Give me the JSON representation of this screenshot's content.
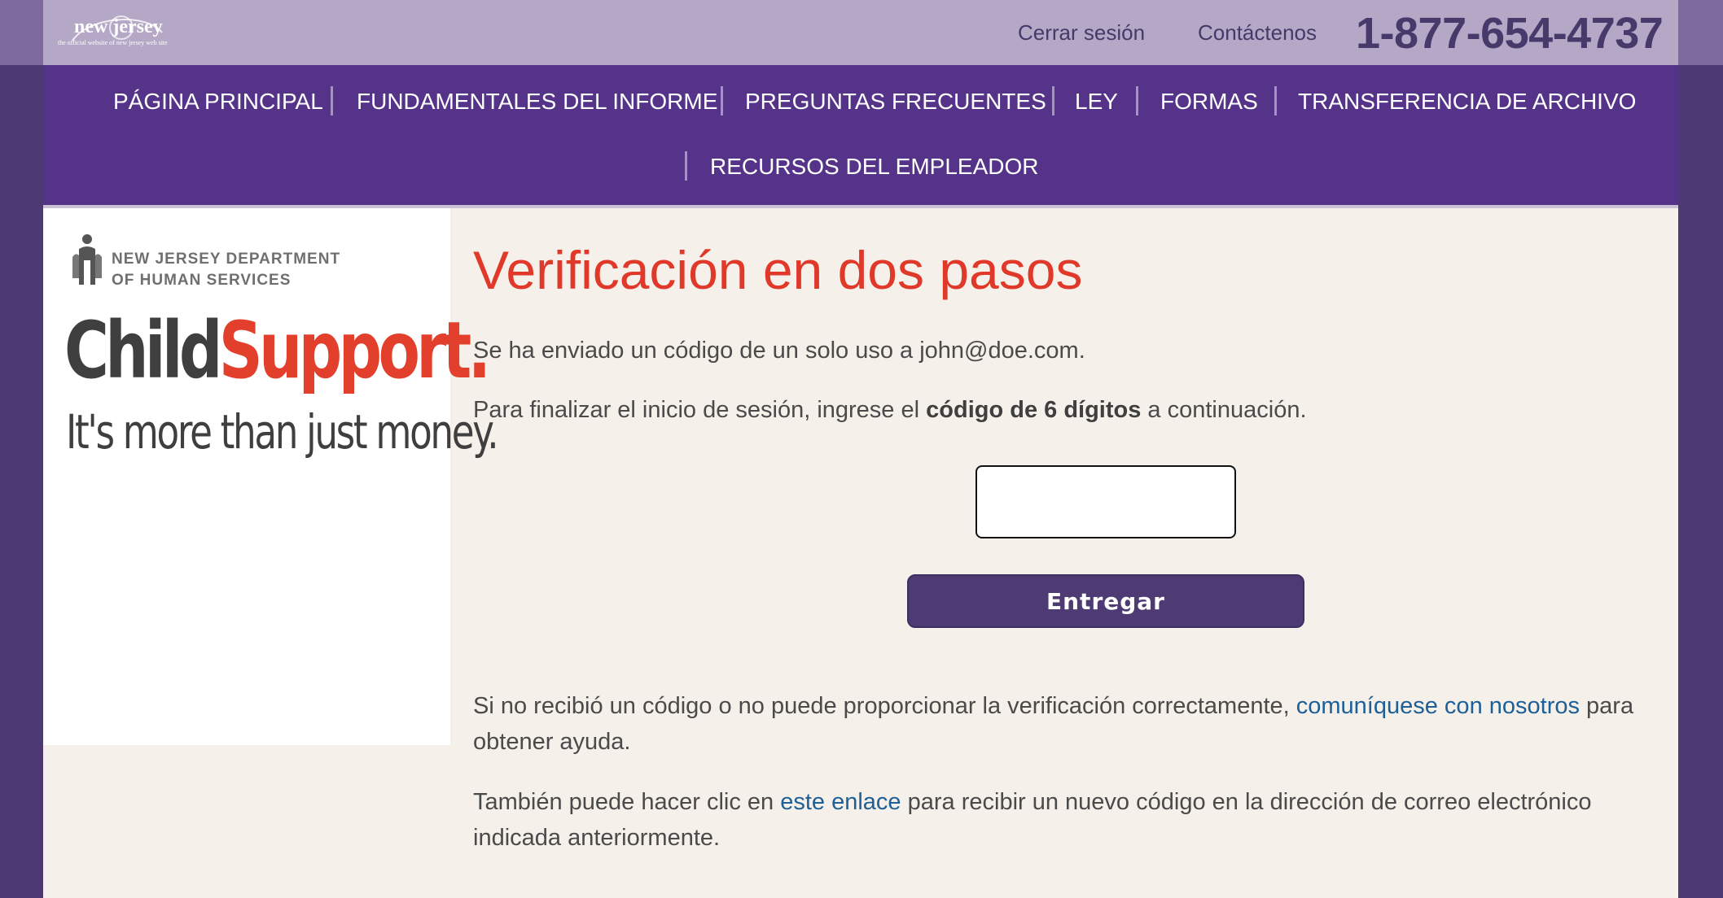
{
  "colors": {
    "outer_background": "#4e3a72",
    "utility_bar": "#b5a8c6",
    "main_nav": "#553389",
    "content_background": "#f5f1ea",
    "heading": "#e0392a",
    "link": "#1d5f96",
    "button": "#4f3b74"
  },
  "header": {
    "logo": {
      "word": "new jersey",
      "tagline": "the official website of new jersey web site"
    },
    "logout_label": "Cerrar sesión",
    "contact_label": "Contáctenos",
    "phone": "1-877-654-4737"
  },
  "nav": {
    "items": [
      {
        "label": "PÁGINA PRINCIPAL"
      },
      {
        "label": "FUNDAMENTALES DEL INFORME"
      },
      {
        "label": "PREGUNTAS FRECUENTES"
      },
      {
        "label": "LEY"
      },
      {
        "label": "FORMAS"
      },
      {
        "label": "TRANSFERENCIA DE ARCHIVO"
      },
      {
        "label": "RECURSOS DEL EMPLEADOR"
      }
    ]
  },
  "sidebar": {
    "dept_line1": "NEW JERSEY DEPARTMENT",
    "dept_line2": "OF HUMAN SERVICES",
    "brand_child": "Child",
    "brand_support": "Support.",
    "brand_tagline": "It's more than just money."
  },
  "main": {
    "title": "Verificación en dos pasos",
    "sent_text": "Se ha enviado un código de un solo uso a john@doe.com.",
    "instr_before": "Para finalizar el inicio de sesión, ingrese el ",
    "instr_bold": "código de 6 dígitos",
    "instr_after": " a continuación.",
    "code_value": "",
    "submit_label": "Entregar",
    "help_before": "Si no recibió un código o no puede proporcionar la verificación correctamente, ",
    "help_link": "comuníquese con nosotros",
    "help_after": " para obtener ayuda.",
    "resend_before": "También puede hacer clic en ",
    "resend_link": "este enlace",
    "resend_after": " para recibir un nuevo código en la dirección de correo electrónico indicada anteriormente."
  }
}
